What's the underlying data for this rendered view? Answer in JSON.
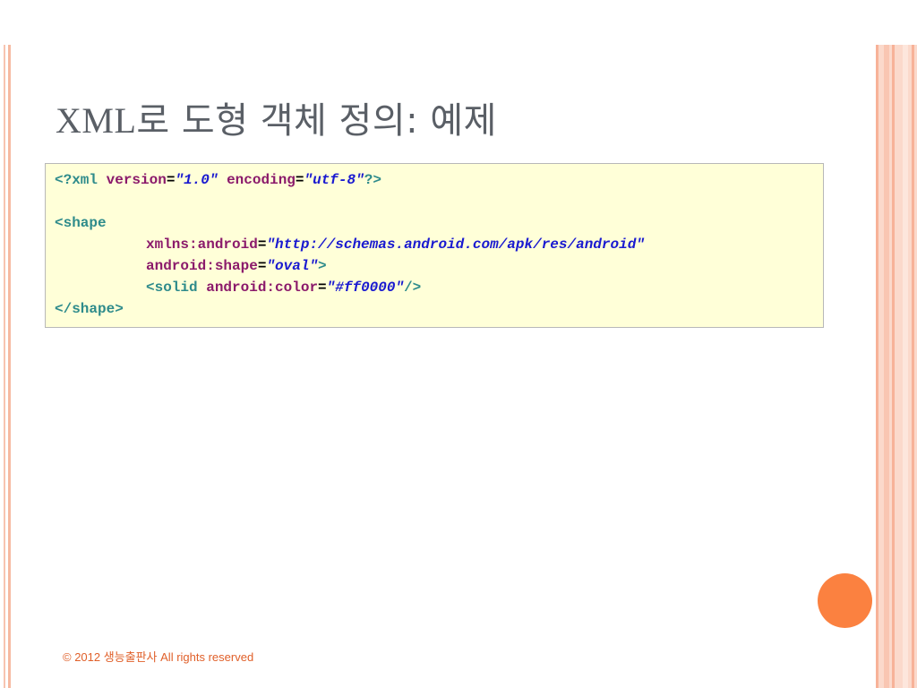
{
  "slide": {
    "title_latin": "XML",
    "title_korean": "로 도형 객체 정의: 예제",
    "footer": "© 2012 생능출판사  All rights reserved"
  },
  "code": {
    "line1": {
      "open": "<?xml",
      "attr1": "version",
      "eq1": "=",
      "val1": "\"1.0\"",
      "attr2": "encoding",
      "eq2": "=",
      "val2": "\"utf-8\"",
      "close": "?>"
    },
    "line2": "",
    "line3": {
      "open": "<shape"
    },
    "line4": {
      "attr": "xmlns:android",
      "eq": "=",
      "val": "\"http://schemas.android.com/apk/res/android\""
    },
    "line5": {
      "attr": "android:shape",
      "eq": "=",
      "val": "\"oval\"",
      "close": ">"
    },
    "line6": {
      "open": "<solid",
      "attr": "android:color",
      "eq": "=",
      "val": "\"#ff0000\"",
      "close": "/>"
    },
    "line7": {
      "close": "</shape>"
    }
  },
  "colors": {
    "code_background": "#ffffd8",
    "accent_orange": "#fb8140",
    "tag": "#2e8b8b",
    "attribute": "#8b1a6b",
    "value": "#1a1ad0",
    "title": "#5a5f66",
    "footer": "#e0602a"
  }
}
